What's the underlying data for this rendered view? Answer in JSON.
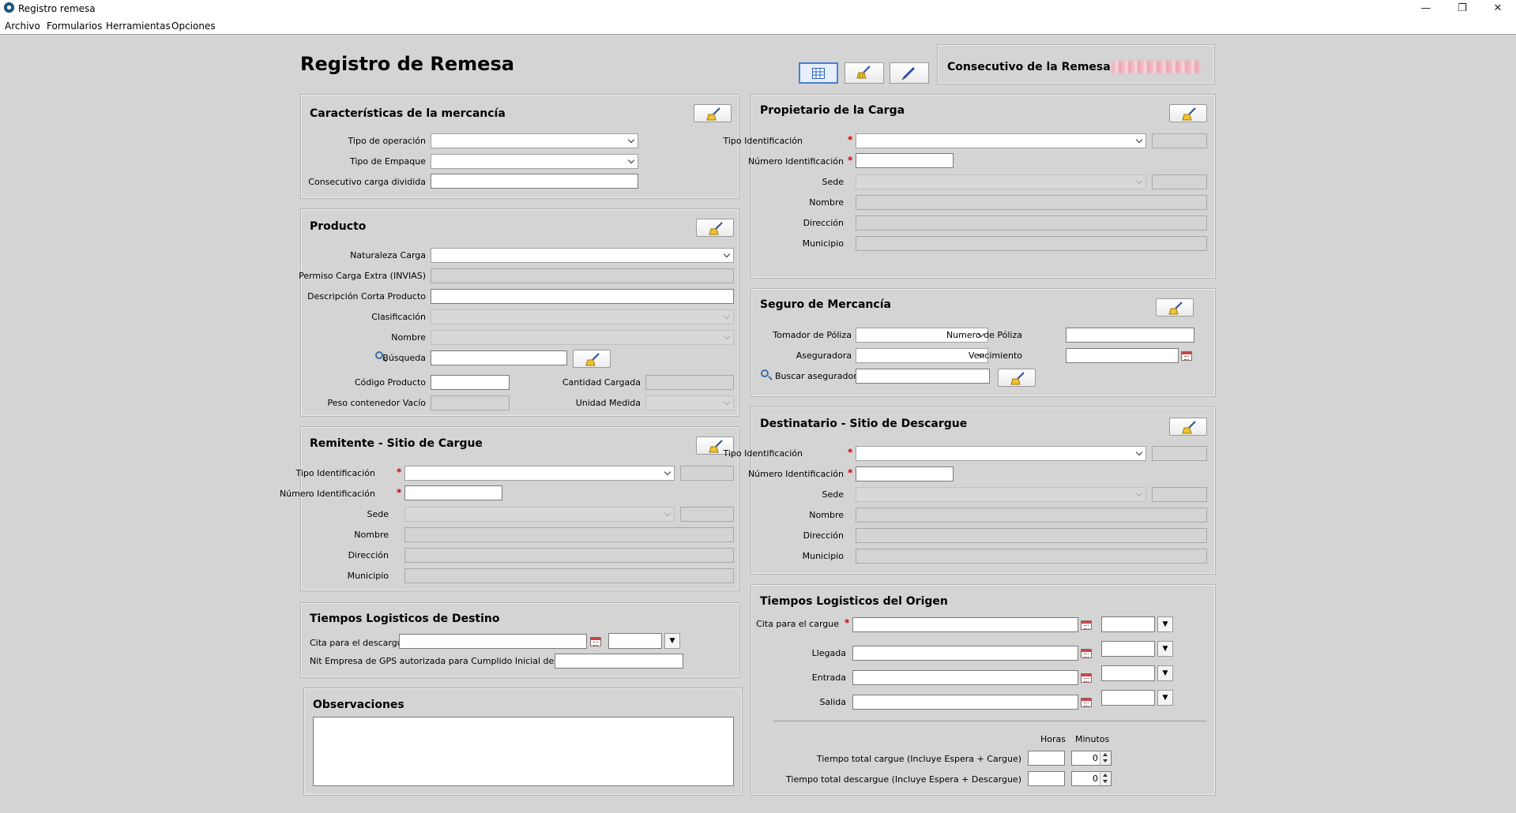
{
  "window": {
    "title": "Registro remesa"
  },
  "menu": [
    "Archivo",
    "Formularios",
    "Herramientas",
    "Opciones"
  ],
  "page": {
    "title": "Registro de Remesa",
    "consecutivo_label": "Consecutivo de la Remesa"
  },
  "caracteristicas": {
    "title": "Características de la mercancía",
    "tipo_operacion": "Tipo de operación",
    "tipo_empaque": "Tipo de Empaque",
    "consecutivo_carga": "Consecutivo carga dividida"
  },
  "producto": {
    "title": "Producto",
    "naturaleza": "Naturaleza Carga",
    "permiso": "Permiso Carga Extra (INVIAS)",
    "descripcion": "Descripción Corta Producto",
    "clasificacion": "Clasificación",
    "nombre": "Nombre",
    "busqueda": "Búsqueda",
    "codigo": "Código Producto",
    "cantidad": "Cantidad Cargada",
    "peso": "Peso contenedor Vacío",
    "unidad": "Unidad Medida"
  },
  "remitente": {
    "title": "Remitente - Sitio de Cargue",
    "tipo_id": "Tipo Identificación",
    "numero_id": "Número Identificación",
    "sede": "Sede",
    "nombre": "Nombre",
    "direccion": "Dirección",
    "municipio": "Municipio"
  },
  "destino": {
    "title": "Tiempos Logisticos de Destino",
    "cita": "Cita para el descargue",
    "nit": "Nit Empresa de GPS autorizada para Cumplido Inicial de Remesa"
  },
  "observaciones": {
    "title": "Observaciones"
  },
  "propietario": {
    "title": "Propietario de la Carga",
    "tipo_id": "Tipo Identificación",
    "numero_id": "Número Identificación",
    "sede": "Sede",
    "nombre": "Nombre",
    "direccion": "Dirección",
    "municipio": "Municipio"
  },
  "seguro": {
    "title": "Seguro de Mercancía",
    "tomador": "Tomador de Póliza",
    "numero_poliza": "Numero de Póliza",
    "aseguradora": "Aseguradora",
    "vencimiento": "Vencimiento",
    "buscar": "Buscar aseguradora"
  },
  "destinatario": {
    "title": "Destinatario - Sitio de Descargue",
    "tipo_id": "Tipo Identificación",
    "numero_id": "Número Identificación",
    "sede": "Sede",
    "nombre": "Nombre",
    "direccion": "Dirección",
    "municipio": "Municipio"
  },
  "origen": {
    "title": "Tiempos Logisticos del Origen",
    "cita": "Cita para el cargue",
    "llegada": "Llegada",
    "entrada": "Entrada",
    "salida": "Salida",
    "horas": "Horas",
    "minutos": "Minutos",
    "total_cargue": "Tiempo total cargue (Incluye Espera + Cargue)",
    "total_descargue": "Tiempo total descargue (Incluye Espera + Descargue)",
    "total_cargue_min": "0",
    "total_descargue_min": "0"
  },
  "icons": {
    "broom": "broom-icon",
    "search": "search-icon",
    "calendar": "calendar-icon",
    "grid": "grid-icon",
    "pen": "pen-icon"
  },
  "colors": {
    "background": "#d4d4d4",
    "required": "#d00000",
    "active_button": "#4a7fd0"
  }
}
